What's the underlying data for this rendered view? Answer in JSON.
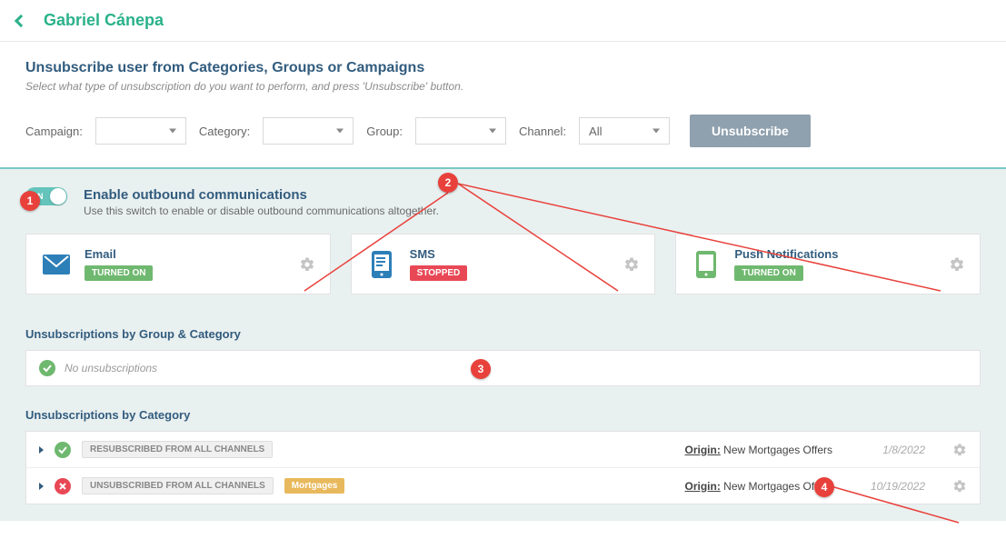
{
  "header": {
    "title": "Gabriel Cánepa"
  },
  "unsubscribe": {
    "title": "Unsubscribe user from Categories, Groups or Campaigns",
    "subtitle": "Select what type of unsubscription do you want to perform, and press 'Unsubscribe' button.",
    "labels": {
      "campaign": "Campaign:",
      "category": "Category:",
      "group": "Group:",
      "channel": "Channel:"
    },
    "channel_value": "All",
    "button": "Unsubscribe"
  },
  "enable": {
    "toggle_state": "ON",
    "title": "Enable outbound communications",
    "desc": "Use this switch to enable or disable outbound communications altogether."
  },
  "channels": [
    {
      "name": "Email",
      "status": "TURNED ON",
      "status_class": "on"
    },
    {
      "name": "SMS",
      "status": "STOPPED",
      "status_class": "off"
    },
    {
      "name": "Push Notifications",
      "status": "TURNED ON",
      "status_class": "on"
    }
  ],
  "group_section": {
    "heading": "Unsubscriptions by Group & Category",
    "empty": "No unsubscriptions"
  },
  "cat_section": {
    "heading": "Unsubscriptions by Category",
    "origin_label": "Origin:",
    "rows": [
      {
        "status_icon": "check",
        "pill": "RESUBSCRIBED FROM ALL CHANNELS",
        "tag": "",
        "origin": "New Mortgages Offers",
        "date": "1/8/2022"
      },
      {
        "status_icon": "cross",
        "pill": "UNSUBSCRIBED FROM ALL CHANNELS",
        "tag": "Mortgages",
        "origin": "New Mortgages Offers",
        "date": "10/19/2022"
      }
    ]
  },
  "annotations": [
    "1",
    "2",
    "3",
    "4"
  ]
}
